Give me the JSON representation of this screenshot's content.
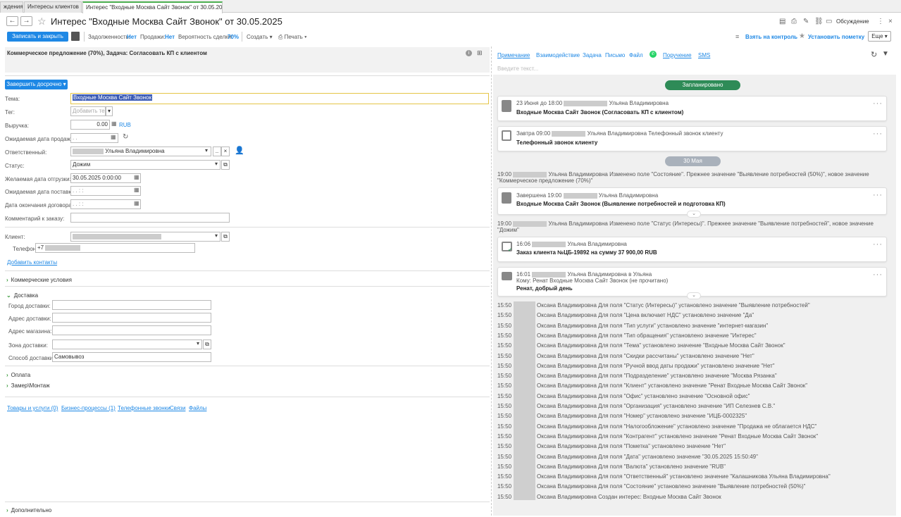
{
  "tabs": [
    {
      "label": "ждения",
      "close": "×"
    },
    {
      "label": "Интересы клиентов",
      "close": "×"
    },
    {
      "label": "Интерес \"Входные Москва Сайт Звонок\" от 30.05.2025",
      "close": "×"
    }
  ],
  "header": {
    "back": "←",
    "forward": "→",
    "star": "☆",
    "title": "Интерес \"Входные Москва Сайт Звонок\" от 30.05.2025",
    "discussion": "Обсуждение"
  },
  "toolbar": {
    "save_close": "Записать и закрыть",
    "debt_label": "Задолженность:",
    "debt_value": "Нет",
    "sales_label": "Продажи:",
    "sales_value": "Нет",
    "prob_label": "Вероятность сделки:",
    "prob_value": "70%",
    "create": "Создать",
    "print": "Печать",
    "control": "Взять на контроль",
    "mark": "Установить пометку",
    "more": "Еще"
  },
  "info": {
    "text": "Коммерческое предложение  (70%), Задача: Согласовать КП с клиентом"
  },
  "form": {
    "finish_button": "Завершить досрочно",
    "tema_label": "Тема:",
    "tema_value": "Входные Москва Сайт Звонок",
    "tag_label": "Тег:",
    "tag_placeholder": "Добавить тег",
    "revenue_label": "Выручка:",
    "revenue_value": "0.00",
    "currency": "RUB",
    "sale_date_label": "Ожидаемая дата продажи:",
    "sale_date_value": ". .",
    "resp_label": "Ответственный:",
    "resp_value": "Ульяна Владимировна",
    "status_label": "Статус:",
    "status_value": "Дожим",
    "ship_label": "Желаемая дата отгрузки:",
    "ship_value": "30.05.2025  0:00:00",
    "delivery_date_label": "Ожидаемая дата поставки:",
    "delivery_date_value": ". .   : :",
    "contract_label": "Дата окончания договора:",
    "contract_value": ". .   : :",
    "comment_label": "Комментарий к заказу:",
    "client_label": "Клиент:",
    "phone_label": "Телефон:",
    "phone_value": "+7",
    "add_contacts": "Добавить контакты",
    "commercial": "Коммерческие условия",
    "delivery": "Доставка",
    "city_label": "Город доставки:",
    "address_label": "Адрес доставки:",
    "shop_label": "Адрес магазина:",
    "zone_label": "Зона доставки:",
    "method_label": "Способ доставки:",
    "method_value": "Самовывоз",
    "payment": "Оплата",
    "measure": "Замер\\Монтаж",
    "links": [
      "Товары и услуги (0)",
      "Бизнес-процессы (1)",
      "Телефонные звонки",
      "Связи",
      "Файлы"
    ],
    "additional": "Дополнительно"
  },
  "right": {
    "tabs": [
      "Примечание",
      "Взаимодействие",
      "Задача",
      "Письмо",
      "Файл",
      "Поручение",
      "SMS"
    ],
    "input_placeholder": "Введите текст...",
    "planned": "Запланировано",
    "card1": {
      "time": "23 Июня до 18:00",
      "user": "Ульяна Владимировна",
      "title": "Входные Москва Сайт Звонок (Согласовать КП с клиентом)"
    },
    "card2": {
      "time": "Завтра 09:00",
      "user": "Ульяна Владимировна Телефонный звонок клиенту",
      "title": "Телефонный звонок клиенту"
    },
    "date_badge": "30 Мая",
    "h1a": "19:00",
    "h1b": "Ульяна Владимировна Изменено поле \"Состояние\". Прежнее значение \"Выявление потребностей (50%)\", новое значение",
    "h1c": "\"Коммерческое предложение (70%)\"",
    "card3": {
      "time": "Завершена 19:00",
      "user": "Ульяна Владимировна",
      "title": "Входные Москва Сайт Звонок (Выявление потребностей и подготовка КП)"
    },
    "h2a": "19:00",
    "h2b": "Ульяна Владимировна Изменено поле \"Статус (Интересы)\". Прежнее значение \"Выявление потребностей\", новое значение",
    "h2c": "\"Дожим\"",
    "card4": {
      "time": "16:06",
      "user": "Ульяна Владимировна",
      "title": "Заказ клиента №ЦБ-19892 на сумму 37 900,00 RUB"
    },
    "card5": {
      "time": "16:01",
      "user": "Ульяна Владимировна в Ульяна",
      "sub": "Кому: Ренат Входные Москва Сайт Звонок (не прочитано)",
      "title": "Ренат, добрый день"
    },
    "history": [
      {
        "t": "15:50",
        "m": "Оксана Владимировна Для поля \"Статус (Интересы)\" установлено значение \"Выявление потребностей\""
      },
      {
        "t": "15:50",
        "m": "Оксана Владимировна Для поля \"Цена включает НДС\" установлено значение \"Да\""
      },
      {
        "t": "15:50",
        "m": "Оксана Владимировна Для поля \"Тип услуги\" установлено значение \"интернет-магазин\""
      },
      {
        "t": "15:50",
        "m": "Оксана Владимировна Для поля \"Тип обращения\" установлено значение \"Интерес\""
      },
      {
        "t": "15:50",
        "m": "Оксана Владимировна Для поля \"Тема\" установлено значение \"Входные Москва Сайт Звонок\""
      },
      {
        "t": "15:50",
        "m": "Оксана Владимировна Для поля \"Скидки рассчитаны\" установлено значение \"Нет\""
      },
      {
        "t": "15:50",
        "m": "Оксана Владимировна Для поля \"Ручной ввод даты продажи\" установлено значение \"Нет\""
      },
      {
        "t": "15:50",
        "m": "Оксана Владимировна Для поля \"Подразделение\" установлено значение \"Москва Рязанка\""
      },
      {
        "t": "15:50",
        "m": "Оксана Владимировна Для поля \"Клиент\" установлено значение \"Ренат Входные Москва Сайт Звонок\""
      },
      {
        "t": "15:50",
        "m": "Оксана Владимировна Для поля \"Офис\" установлено значение \"Основной офис\""
      },
      {
        "t": "15:50",
        "m": "Оксана Владимировна Для поля \"Организация\" установлено значение \"ИП Селезнев С.В.\""
      },
      {
        "t": "15:50",
        "m": "Оксана Владимировна Для поля \"Номер\" установлено значение \"ИЦБ-0002325\""
      },
      {
        "t": "15:50",
        "m": "Оксана Владимировна Для поля \"Налогообложение\" установлено значение \"Продажа не облагается НДС\""
      },
      {
        "t": "15:50",
        "m": "Оксана Владимировна Для поля \"Контрагент\" установлено значение \"Ренат Входные Москва Сайт Звонок\""
      },
      {
        "t": "15:50",
        "m": "Оксана Владимировна Для поля \"Пометка\" установлено значение \"Нет\""
      },
      {
        "t": "15:50",
        "m": "Оксана Владимировна Для поля \"Дата\" установлено значение \"30.05.2025 15:50:49\""
      },
      {
        "t": "15:50",
        "m": "Оксана Владимировна Для поля \"Валюта\" установлено значение \"RUB\""
      },
      {
        "t": "15:50",
        "m": "Оксана Владимировна Для поля \"Ответственный\" установлено значение \"Калашникова Ульяна Владимировна\""
      },
      {
        "t": "15:50",
        "m": "Оксана Владимировна Для поля \"Состояние\" установлено значение \"Выявление потребностей (50%)\""
      },
      {
        "t": "15:50",
        "m": "Оксана Владимировна Создан интерес: Входные Москва Сайт Звонок"
      }
    ]
  }
}
